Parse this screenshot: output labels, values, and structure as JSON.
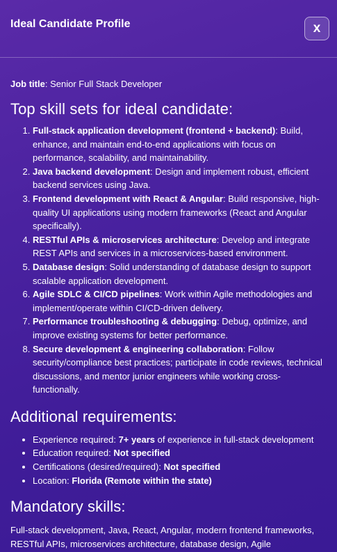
{
  "header": {
    "title": "Ideal Candidate Profile",
    "close_label": "x",
    "close_icon": "close-icon"
  },
  "job": {
    "label": "Job title",
    "separator": ": ",
    "value": "Senior Full Stack Developer"
  },
  "skills": {
    "heading": "Top skill sets for ideal candidate:",
    "items": [
      {
        "title": "Full-stack application development (frontend + backend)",
        "desc": ": Build, enhance, and maintain end-to-end applications with focus on performance, scalability, and maintainability."
      },
      {
        "title": "Java backend development",
        "desc": ": Design and implement robust, efficient backend services using Java."
      },
      {
        "title": "Frontend development with React & Angular",
        "desc": ": Build responsive, high-quality UI applications using modern frameworks (React and Angular specifically)."
      },
      {
        "title": "RESTful APIs & microservices architecture",
        "desc": ": Develop and integrate REST APIs and services in a microservices-based environment."
      },
      {
        "title": "Database design",
        "desc": ": Solid understanding of database design to support scalable application development."
      },
      {
        "title": "Agile SDLC & CI/CD pipelines",
        "desc": ": Work within Agile methodologies and implement/operate within CI/CD-driven delivery."
      },
      {
        "title": "Performance troubleshooting & debugging",
        "desc": ": Debug, optimize, and improve existing systems for better performance."
      },
      {
        "title": "Secure development & engineering collaboration",
        "desc": ": Follow security/compliance best practices; participate in code reviews, technical discussions, and mentor junior engineers while working cross-functionally."
      }
    ]
  },
  "additional": {
    "heading": "Additional requirements:",
    "items": [
      {
        "label": "Experience required: ",
        "value": "7+ years",
        "suffix": " of experience in full-stack development"
      },
      {
        "label": "Education required: ",
        "value": "Not specified",
        "suffix": ""
      },
      {
        "label": "Certifications (desired/required): ",
        "value": "Not specified",
        "suffix": ""
      },
      {
        "label": "Location: ",
        "value": "Florida (Remote within the state)",
        "suffix": ""
      }
    ]
  },
  "mandatory": {
    "heading": "Mandatory skills:",
    "text": "Full-stack development, Java, React, Angular, modern frontend frameworks, RESTful APIs, microservices architecture, database design, Agile"
  }
}
